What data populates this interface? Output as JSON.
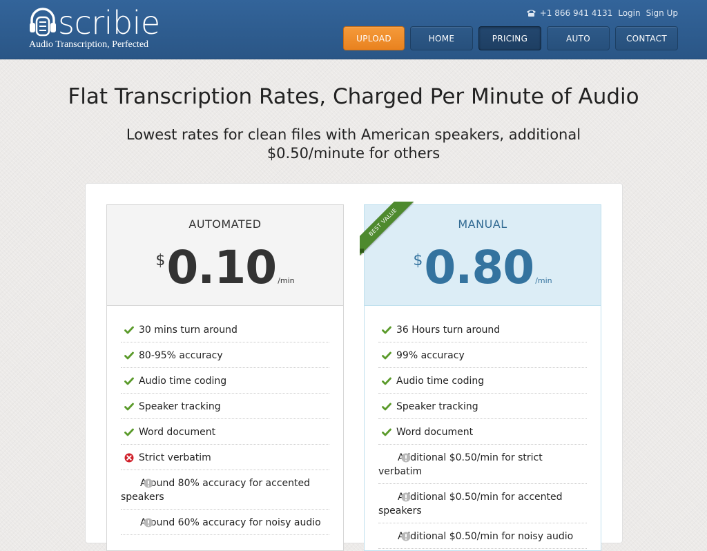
{
  "header": {
    "logo_text": "scribie",
    "tagline": "Audio Transcription, Perfected",
    "phone": "+1 866 941 4131",
    "login": "Login",
    "signup": "Sign Up",
    "nav": [
      "UPLOAD",
      "HOME",
      "PRICING",
      "AUTO",
      "CONTACT"
    ],
    "active_nav": "PRICING"
  },
  "main": {
    "title": "Flat Transcription Rates, Charged Per Minute of Audio",
    "subtitle": "Lowest rates for clean files with American speakers, additional $0.50/minute for others"
  },
  "plans": {
    "auto": {
      "name": "AUTOMATED",
      "currency": "$",
      "price": "0.10",
      "unit": "/min",
      "features": [
        {
          "icon": "check-icon",
          "text": "30 mins turn around"
        },
        {
          "icon": "check-icon",
          "text": "80-95% accuracy"
        },
        {
          "icon": "check-icon",
          "text": "Audio time coding"
        },
        {
          "icon": "check-icon",
          "text": "Speaker tracking"
        },
        {
          "icon": "check-icon",
          "text": "Word document"
        },
        {
          "icon": "cross-icon",
          "text": "Strict verbatim"
        },
        {
          "icon": "info-icon",
          "text": "Around 80% accuracy for accented speakers"
        },
        {
          "icon": "info-icon",
          "text": "Around 60% accuracy for noisy audio"
        }
      ]
    },
    "manual": {
      "name": "MANUAL",
      "currency": "$",
      "price": "0.80",
      "unit": "/min",
      "ribbon": "BEST VALUE",
      "features": [
        {
          "icon": "check-icon",
          "text": "36 Hours turn around"
        },
        {
          "icon": "check-icon",
          "text": "99% accuracy"
        },
        {
          "icon": "check-icon",
          "text": "Audio time coding"
        },
        {
          "icon": "check-icon",
          "text": "Speaker tracking"
        },
        {
          "icon": "check-icon",
          "text": "Word document"
        },
        {
          "icon": "info-icon",
          "text": "Additional $0.50/min for strict verbatim"
        },
        {
          "icon": "info-icon",
          "text": "Additional $0.50/min for accented speakers"
        },
        {
          "icon": "info-icon",
          "text": "Additional $0.50/min for noisy audio"
        }
      ]
    }
  },
  "colors": {
    "header_blue": "#2f5d8d",
    "upload_orange": "#f0902e",
    "check_green": "#5a9a2a",
    "cross_red": "#d0202a",
    "info_gray": "#b8b8b8",
    "manual_blue": "#34739f"
  }
}
